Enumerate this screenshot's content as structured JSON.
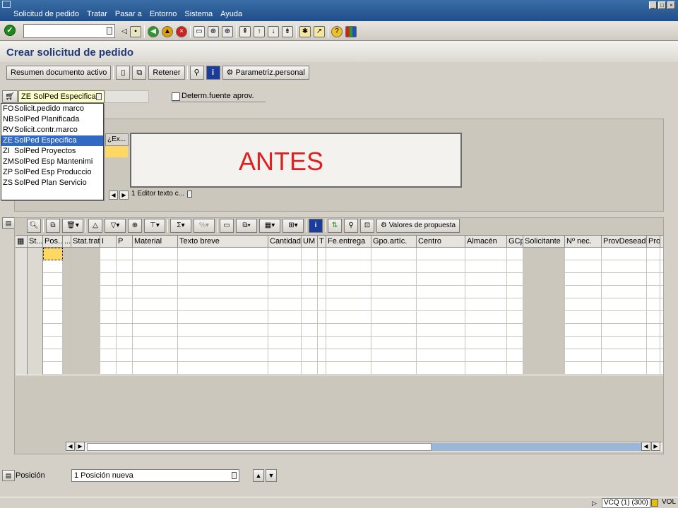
{
  "menubar": {
    "items": [
      "Solicitud de pedido",
      "Tratar",
      "Pasar a",
      "Entorno",
      "Sistema",
      "Ayuda"
    ],
    "window_controls": [
      "minimize",
      "maximize",
      "close"
    ]
  },
  "standard_toolbar": {
    "command_value": "",
    "icons": [
      "enter-icon",
      "save-icon",
      "back-icon",
      "exit-icon",
      "cancel-icon",
      "print-icon",
      "find-icon",
      "find-next-icon",
      "first-page-icon",
      "previous-page-icon",
      "next-page-icon",
      "last-page-icon",
      "new-session-icon",
      "shortcut-icon",
      "help-icon",
      "layout-icon"
    ]
  },
  "page": {
    "title": "Crear solicitud de pedido"
  },
  "app_toolbar": {
    "resumen": "Resumen documento activo",
    "retener": "Retener",
    "parametriz": "Parametriz.personal"
  },
  "header": {
    "doc_type_value": "ZE SolPed Especifica",
    "determ_label": "Determ.fuente aprov.",
    "determ_checked": false
  },
  "doc_type_options": [
    {
      "code": "FO",
      "label": "Solicit.pedido marco"
    },
    {
      "code": "NB",
      "label": "SolPed Planificada"
    },
    {
      "code": "RV",
      "label": "Solicit.contr.marco"
    },
    {
      "code": "ZE",
      "label": "SolPed Especifica",
      "selected": true
    },
    {
      "code": "ZI",
      "label": "SolPed Proyectos"
    },
    {
      "code": "ZM",
      "label": "SolPed Esp Mantenimi"
    },
    {
      "code": "ZP",
      "label": "SolPed Esp Produccio"
    },
    {
      "code": "ZS",
      "label": "SolPed Plan Servicio"
    }
  ],
  "header_texts": {
    "ex_column": "¿Ex...",
    "editor_text": "ANTES",
    "editor_selector": "1 Editor texto c..."
  },
  "item_toolbar": {
    "valores_propuesta": "Valores de propuesta"
  },
  "grid": {
    "columns": [
      "St...",
      "Pos...",
      "...",
      "Stat.trat.",
      "I",
      "P",
      "Material",
      "Texto breve",
      "Cantidad",
      "UM",
      "T",
      "Fe.entrega",
      "Gpo.artíc.",
      "Centro",
      "Almacén",
      "GCp",
      "Solicitante",
      "Nº nec.",
      "ProvDesead",
      "Prov"
    ],
    "row_count": 10
  },
  "position_bar": {
    "label": "Posición",
    "value": "1 Posición nueva"
  },
  "statusbar": {
    "system": "VCQ (1) (300)",
    "server": "VOL"
  },
  "colors": {
    "menubar": "#2a5a99",
    "title": "#1f3a7a",
    "annotation": "#e02020",
    "selection": "#316ac5",
    "focus_cell": "#ffd864"
  }
}
